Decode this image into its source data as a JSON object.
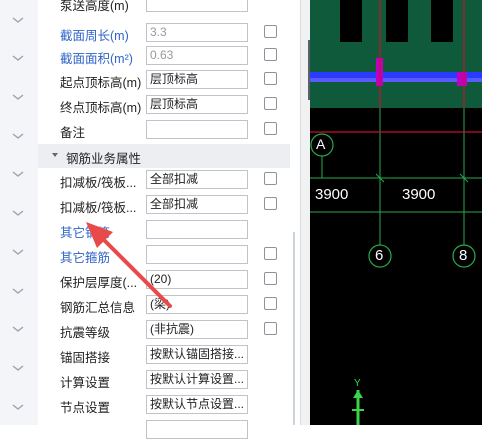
{
  "properties": {
    "rows_top": [
      {
        "label": "泵送高度(m)",
        "value": "",
        "blue": false,
        "readonly": false
      },
      {
        "label": "截面周长(m)",
        "value": "3.3",
        "blue": true,
        "readonly": true
      },
      {
        "label": "截面面积(m²)",
        "value": "0.63",
        "blue": true,
        "readonly": true
      },
      {
        "label": "起点顶标高(m)",
        "value": "层顶标高",
        "blue": false,
        "readonly": false
      },
      {
        "label": "终点顶标高(m)",
        "value": "层顶标高",
        "blue": false,
        "readonly": false
      },
      {
        "label": "备注",
        "value": "",
        "blue": false,
        "readonly": false
      }
    ],
    "group_label": "钢筋业务属性",
    "rows_bottom": [
      {
        "label": "扣减板/筏板...",
        "value": "全部扣减",
        "blue": false,
        "checkbox": true
      },
      {
        "label": "扣减板/筏板...",
        "value": "全部扣减",
        "blue": false,
        "checkbox": true
      },
      {
        "label": "其它钢筋",
        "value": "",
        "blue": true,
        "checkbox": false
      },
      {
        "label": "其它箍筋",
        "value": "",
        "blue": true,
        "checkbox": true
      },
      {
        "label": "保护层厚度(...",
        "value": "(20)",
        "blue": false,
        "checkbox": true
      },
      {
        "label": "钢筋汇总信息",
        "value": "(梁)",
        "blue": false,
        "checkbox": true
      },
      {
        "label": "抗震等级",
        "value": "(非抗震)",
        "blue": false,
        "checkbox": true
      },
      {
        "label": "锚固搭接",
        "value": "按默认锚固搭接...",
        "blue": false,
        "checkbox": false
      },
      {
        "label": "计算设置",
        "value": "按默认计算设置...",
        "blue": false,
        "checkbox": false
      },
      {
        "label": "节点设置",
        "value": "按默认节点设置...",
        "blue": false,
        "checkbox": false
      }
    ]
  },
  "cad": {
    "axis_a": "A",
    "dim_left": "3900",
    "dim_right": "3900",
    "axis_6": "6",
    "axis_8": "8",
    "ucs_y": "Y"
  },
  "colors": {
    "blue_label": "#2f64c8",
    "cad_green": "#0f5a3a",
    "cad_red": "#c8102e",
    "beam_blue": "#3a3aff",
    "magenta": "#c000c0",
    "arrow": "#e84a4a"
  }
}
